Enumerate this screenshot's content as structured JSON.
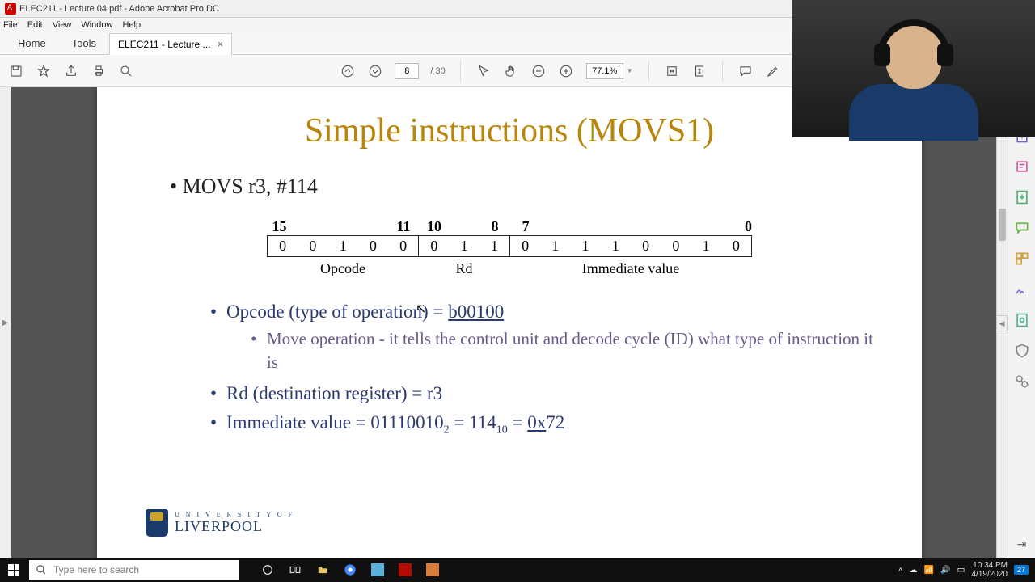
{
  "titlebar": {
    "text": "ELEC211 - Lecture 04.pdf - Adobe Acrobat Pro DC"
  },
  "menubar": {
    "file": "File",
    "edit": "Edit",
    "view": "View",
    "window": "Window",
    "help": "Help"
  },
  "tabs": {
    "home": "Home",
    "tools": "Tools",
    "doc": "ELEC211 - Lecture ..."
  },
  "toolbar": {
    "page_current": "8",
    "page_total": "/ 30",
    "zoom": "77.1%"
  },
  "slide": {
    "title": "Simple instructions (MOVS1)",
    "line1": "MOVS r3, #114",
    "bit_headers": {
      "b15": "15",
      "b11": "11",
      "b10": "10",
      "b8": "8",
      "b7": "7",
      "b0": "0"
    },
    "bits": [
      "0",
      "0",
      "1",
      "0",
      "0",
      "0",
      "1",
      "1",
      "0",
      "1",
      "1",
      "1",
      "0",
      "0",
      "1",
      "0"
    ],
    "labels": {
      "opcode": "Opcode",
      "rd": "Rd",
      "imm": "Immediate value"
    },
    "bul_opcode": "Opcode (type of operation) = ",
    "bul_opcode_val": "b00100",
    "bul_opcode_sub": "Move operation - it tells the control unit and decode cycle (ID) what type of instruction it is",
    "bul_rd": "Rd (destination register) = r3",
    "bul_imm_a": "Immediate value = 01110010",
    "bul_imm_b": " = 114",
    "bul_imm_c": " = ",
    "bul_imm_d": "0x",
    "bul_imm_e": "72",
    "sub2": "2",
    "sub10": "10",
    "logo_u": "U N I V E R S I T Y   O F",
    "logo_l": "LIVERPOOL"
  },
  "taskbar": {
    "search_placeholder": "Type here to search",
    "time": "10:34 PM",
    "date": "4/19/2020",
    "ime": "中",
    "notif": "27"
  }
}
